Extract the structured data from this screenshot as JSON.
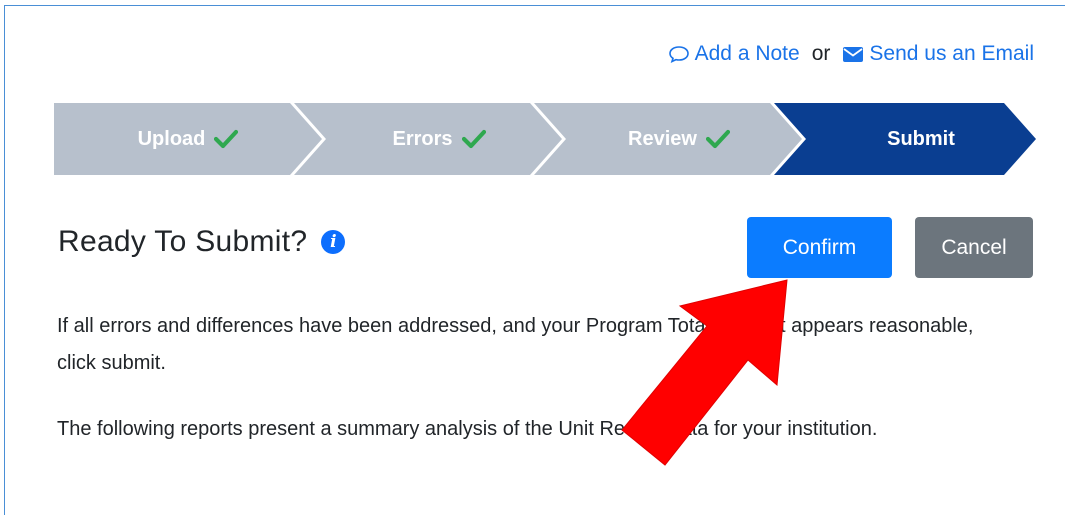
{
  "top_links": {
    "add_note": "Add a Note",
    "or": "or",
    "send_email": "Send us an Email"
  },
  "steps": [
    {
      "label": "Upload",
      "complete": true
    },
    {
      "label": "Errors",
      "complete": true
    },
    {
      "label": "Review",
      "complete": true
    },
    {
      "label": "Submit",
      "complete": false,
      "active": true
    }
  ],
  "colors": {
    "step_inactive": "#b7c0cc",
    "step_active": "#0a3e91",
    "check": "#2fa84f",
    "link": "#1a73e8",
    "confirm": "#0b7cff",
    "cancel": "#6c757d",
    "arrow": "#ff0000"
  },
  "header": {
    "title": "Ready To Submit?",
    "confirm_label": "Confirm",
    "cancel_label": "Cancel"
  },
  "body": {
    "paragraph1": "If all errors and differences have been addressed, and your Program Totals Report appears reasonable, click submit.",
    "paragraph2": "The following reports present a summary analysis of the Unit Record data for your institution."
  }
}
